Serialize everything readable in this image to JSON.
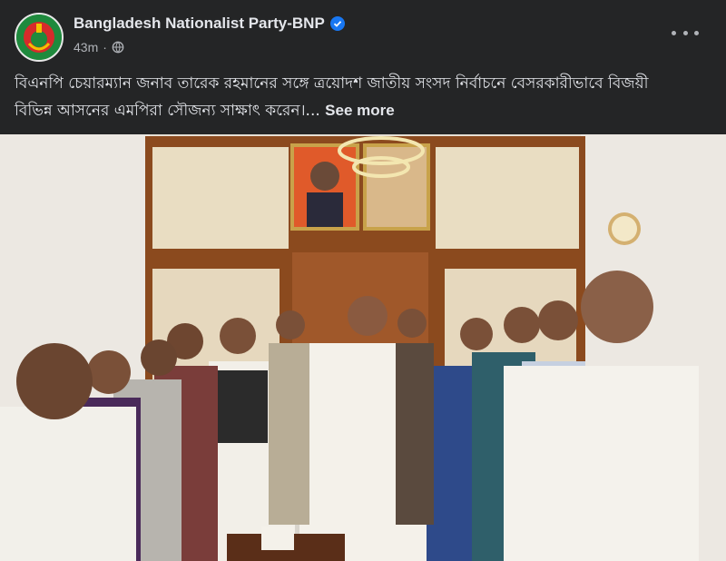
{
  "post": {
    "page_name": "Bangladesh Nationalist Party-BNP",
    "time": "43m",
    "separator": "·",
    "caption_line1": "বিএনপি চেয়ারম্যান জনাব তারেক রহমানের সঙ্গে ত্রয়োদশ জাতীয় সংসদ নির্বাচনে বেসরকারীভাবে বিজয়ী",
    "caption_line2": "বিভিন্ন আসনের এমপিরা সৌজন্য সাক্ষাৎ করেন।...",
    "see_more": "See more"
  },
  "icons": {
    "verified": "verified-badge-icon",
    "audience": "globe-icon",
    "more": "more-options-icon"
  },
  "colors": {
    "background": "#242526",
    "text": "#e4e6eb",
    "secondary_text": "#b0b3b8",
    "verified_blue": "#1877f2",
    "logo_green": "#1f8a3d",
    "logo_red": "#d62b2b"
  }
}
